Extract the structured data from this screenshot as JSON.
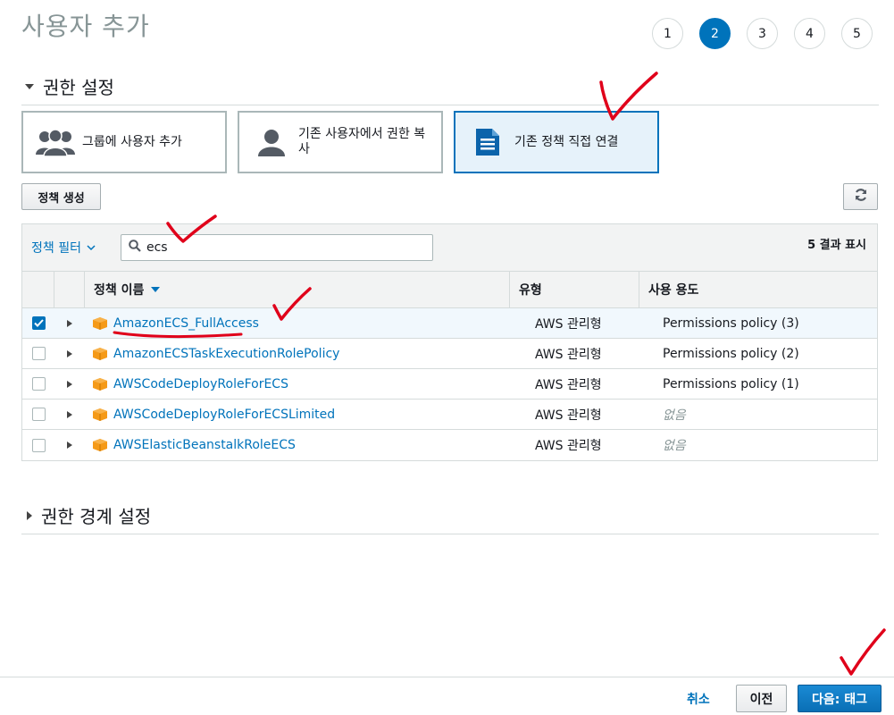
{
  "page": {
    "title": "사용자 추가"
  },
  "steps": [
    "1",
    "2",
    "3",
    "4",
    "5"
  ],
  "active_step": "2",
  "permissions": {
    "section_label": "권한 설정",
    "options": [
      {
        "label": "그룹에 사용자 추가",
        "icon": "users-group-icon",
        "selected": false
      },
      {
        "label": "기존 사용자에서 권한 복사",
        "icon": "user-icon",
        "selected": false
      },
      {
        "label": "기존 정책 직접 연결",
        "icon": "document-icon",
        "selected": true
      }
    ],
    "create_policy_label": "정책 생성",
    "refresh_icon": "refresh-icon"
  },
  "table": {
    "filter_label": "정책 필터",
    "search_value": "ecs",
    "result_count": "5 결과 표시",
    "headers": {
      "name": "정책 이름",
      "type": "유형",
      "usage": "사용 용도"
    },
    "rows": [
      {
        "checked": true,
        "name": "AmazonECS_FullAccess",
        "type": "AWS 관리형",
        "usage": "Permissions policy (3)",
        "usage_muted": false
      },
      {
        "checked": false,
        "name": "AmazonECSTaskExecutionRolePolicy",
        "type": "AWS 관리형",
        "usage": "Permissions policy (2)",
        "usage_muted": false
      },
      {
        "checked": false,
        "name": "AWSCodeDeployRoleForECS",
        "type": "AWS 관리형",
        "usage": "Permissions policy (1)",
        "usage_muted": false
      },
      {
        "checked": false,
        "name": "AWSCodeDeployRoleForECSLimited",
        "type": "AWS 관리형",
        "usage": "없음",
        "usage_muted": true
      },
      {
        "checked": false,
        "name": "AWSElasticBeanstalkRoleECS",
        "type": "AWS 관리형",
        "usage": "없음",
        "usage_muted": true
      }
    ]
  },
  "boundary": {
    "section_label": "권한 경계 설정"
  },
  "footer": {
    "cancel": "취소",
    "previous": "이전",
    "next": "다음: 태그"
  },
  "colors": {
    "accent": "#0073bb",
    "annotation": "#e0001a",
    "policy_icon": "#f59a18"
  }
}
